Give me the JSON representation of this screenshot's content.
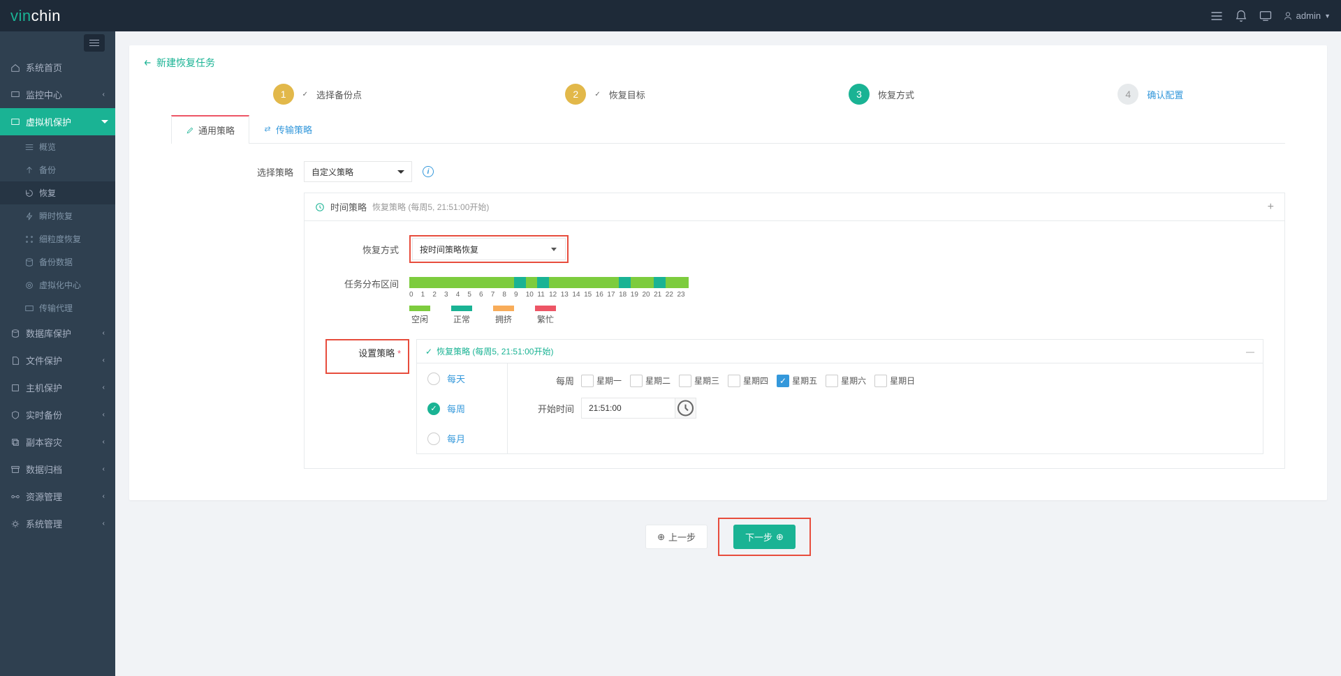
{
  "header": {
    "logo_pre": "vin",
    "logo_post": "chin",
    "user": "admin"
  },
  "sidebar": {
    "items": [
      {
        "label": "系统首页"
      },
      {
        "label": "监控中心"
      },
      {
        "label": "虚拟机保护",
        "sub": [
          {
            "label": "概览"
          },
          {
            "label": "备份"
          },
          {
            "label": "恢复"
          },
          {
            "label": "瞬时恢复"
          },
          {
            "label": "细粒度恢复"
          },
          {
            "label": "备份数据"
          },
          {
            "label": "虚拟化中心"
          },
          {
            "label": "传输代理"
          }
        ]
      },
      {
        "label": "数据库保护"
      },
      {
        "label": "文件保护"
      },
      {
        "label": "主机保护"
      },
      {
        "label": "实时备份"
      },
      {
        "label": "副本容灾"
      },
      {
        "label": "数据归档"
      },
      {
        "label": "资源管理"
      },
      {
        "label": "系统管理"
      }
    ]
  },
  "breadcrumb": "新建恢复任务",
  "steps": [
    {
      "num": "1",
      "label": "选择备份点",
      "done": true
    },
    {
      "num": "2",
      "label": "恢复目标",
      "done": true
    },
    {
      "num": "3",
      "label": "恢复方式",
      "current": true
    },
    {
      "num": "4",
      "label": "确认配置",
      "future": true
    }
  ],
  "tabs": [
    {
      "label": "通用策略",
      "active": true
    },
    {
      "label": "传输策略"
    }
  ],
  "form": {
    "policyLabel": "选择策略",
    "policyValue": "自定义策略",
    "timePolicy": {
      "title": "时间策略",
      "subtitle": "恢复策略 (每周5, 21:51:00开始)"
    },
    "restoreMode": {
      "label": "恢复方式",
      "value": "按时间策略恢复"
    },
    "distribution": {
      "label": "任务分布区间"
    },
    "legend": {
      "idle": "空闲",
      "normal": "正常",
      "crowded": "拥挤",
      "busy": "繁忙"
    },
    "setPolicy": {
      "label": "设置策略",
      "summary": "恢复策略 (每周5, 21:51:00开始)"
    },
    "freq": {
      "daily": "每天",
      "weekly": "每周",
      "monthly": "每月"
    },
    "weekly": {
      "label": "每周",
      "days": [
        "星期一",
        "星期二",
        "星期三",
        "星期四",
        "星期五",
        "星期六",
        "星期日"
      ],
      "checked": "星期五"
    },
    "startTime": {
      "label": "开始时间",
      "value": "21:51:00"
    },
    "hours": [
      "0",
      "1",
      "2",
      "3",
      "4",
      "5",
      "6",
      "7",
      "8",
      "9",
      "10",
      "11",
      "12",
      "13",
      "14",
      "15",
      "16",
      "17",
      "18",
      "19",
      "20",
      "21",
      "22",
      "23"
    ]
  },
  "buttons": {
    "prev": "上一步",
    "next": "下一步"
  }
}
